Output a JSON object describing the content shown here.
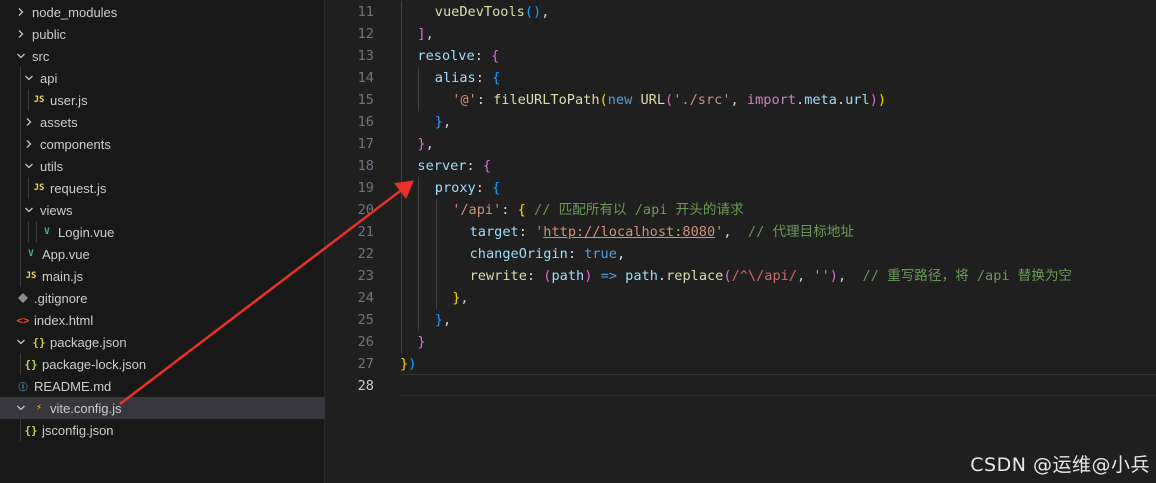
{
  "explorer": {
    "items": [
      {
        "label": "node_modules",
        "type": "folder",
        "expanded": false
      },
      {
        "label": "public",
        "type": "folder",
        "expanded": false
      },
      {
        "label": "src",
        "type": "folder",
        "expanded": true
      },
      {
        "label": "api",
        "type": "folder",
        "expanded": true
      },
      {
        "label": "user.js",
        "type": "js"
      },
      {
        "label": "assets",
        "type": "folder",
        "expanded": false
      },
      {
        "label": "components",
        "type": "folder",
        "expanded": false
      },
      {
        "label": "utils",
        "type": "folder",
        "expanded": true
      },
      {
        "label": "request.js",
        "type": "js"
      },
      {
        "label": "views",
        "type": "folder",
        "expanded": true
      },
      {
        "label": "Login.vue",
        "type": "vue"
      },
      {
        "label": "App.vue",
        "type": "vue"
      },
      {
        "label": "main.js",
        "type": "js"
      },
      {
        "label": ".gitignore",
        "type": "git"
      },
      {
        "label": "index.html",
        "type": "html"
      },
      {
        "label": "package.json",
        "type": "json",
        "expandable": true
      },
      {
        "label": "package-lock.json",
        "type": "json"
      },
      {
        "label": "README.md",
        "type": "info"
      },
      {
        "label": "vite.config.js",
        "type": "vite",
        "expandable": true,
        "selected": true
      },
      {
        "label": "jsconfig.json",
        "type": "json"
      }
    ],
    "icons": {
      "js": "JS",
      "json": "{}",
      "vue": "V",
      "html": "<>",
      "info": "ⓘ",
      "vite": "⚡"
    }
  },
  "editor": {
    "active_line": 28,
    "lines": [
      {
        "n": "11",
        "tokens": [
          [
            "t-fn",
            "vueDevTools"
          ],
          [
            "t-p3",
            "()"
          ],
          [
            "t-plain",
            ","
          ]
        ]
      },
      {
        "n": "12",
        "tokens": [
          [
            "t-p2",
            "]"
          ],
          [
            "t-plain",
            ","
          ]
        ]
      },
      {
        "n": "13",
        "tokens": [
          [
            "t-prop",
            "resolve"
          ],
          [
            "t-plain",
            ": "
          ],
          [
            "t-p2",
            "{"
          ]
        ]
      },
      {
        "n": "14",
        "tokens": [
          [
            "t-prop",
            "alias"
          ],
          [
            "t-plain",
            ": "
          ],
          [
            "t-p3",
            "{"
          ]
        ]
      },
      {
        "n": "15",
        "tokens": [
          [
            "t-str",
            "'@'"
          ],
          [
            "t-plain",
            ": "
          ],
          [
            "t-fn",
            "fileURLToPath"
          ],
          [
            "t-p1",
            "("
          ],
          [
            "t-kw",
            "new "
          ],
          [
            "t-fn",
            "URL"
          ],
          [
            "t-p2",
            "("
          ],
          [
            "t-str",
            "'./src'"
          ],
          [
            "t-plain",
            ", "
          ],
          [
            "t-ctl",
            "import"
          ],
          [
            "t-plain",
            "."
          ],
          [
            "t-prop",
            "meta"
          ],
          [
            "t-plain",
            "."
          ],
          [
            "t-prop",
            "url"
          ],
          [
            "t-p2",
            ")"
          ],
          [
            "t-p1",
            ")"
          ]
        ]
      },
      {
        "n": "16",
        "tokens": [
          [
            "t-p3",
            "}"
          ],
          [
            "t-plain",
            ","
          ]
        ]
      },
      {
        "n": "17",
        "tokens": [
          [
            "t-p2",
            "}"
          ],
          [
            "t-plain",
            ","
          ]
        ]
      },
      {
        "n": "18",
        "tokens": [
          [
            "t-prop",
            "server"
          ],
          [
            "t-plain",
            ": "
          ],
          [
            "t-p2",
            "{"
          ]
        ]
      },
      {
        "n": "19",
        "tokens": [
          [
            "t-prop",
            "proxy"
          ],
          [
            "t-plain",
            ": "
          ],
          [
            "t-p3",
            "{"
          ]
        ]
      },
      {
        "n": "20",
        "tokens": [
          [
            "t-str",
            "'/api'"
          ],
          [
            "t-plain",
            ": "
          ],
          [
            "t-p1",
            "{"
          ],
          [
            "t-plain",
            " "
          ],
          [
            "t-com",
            "// 匹配所有以 /api 开头的请求"
          ]
        ]
      },
      {
        "n": "21",
        "tokens": [
          [
            "t-prop",
            "target"
          ],
          [
            "t-plain",
            ": "
          ],
          [
            "t-str",
            "'"
          ],
          [
            "t-url",
            "http://localhost:8080"
          ],
          [
            "t-str",
            "'"
          ],
          [
            "t-plain",
            ",  "
          ],
          [
            "t-com",
            "// 代理目标地址"
          ]
        ]
      },
      {
        "n": "22",
        "tokens": [
          [
            "t-prop",
            "changeOrigin"
          ],
          [
            "t-plain",
            ": "
          ],
          [
            "t-bool",
            "true"
          ],
          [
            "t-plain",
            ","
          ]
        ]
      },
      {
        "n": "23",
        "tokens": [
          [
            "t-fn",
            "rewrite"
          ],
          [
            "t-plain",
            ": "
          ],
          [
            "t-p2",
            "("
          ],
          [
            "t-prop",
            "path"
          ],
          [
            "t-p2",
            ")"
          ],
          [
            "t-plain",
            " "
          ],
          [
            "t-kw",
            "=>"
          ],
          [
            "t-plain",
            " "
          ],
          [
            "t-prop",
            "path"
          ],
          [
            "t-plain",
            "."
          ],
          [
            "t-fn",
            "replace"
          ],
          [
            "t-p2",
            "("
          ],
          [
            "t-re",
            "/^\\/api/"
          ],
          [
            "t-plain",
            ", "
          ],
          [
            "t-str",
            "''"
          ],
          [
            "t-p2",
            ")"
          ],
          [
            "t-plain",
            ",  "
          ],
          [
            "t-com",
            "// 重写路径，将 /api 替换为空"
          ]
        ]
      },
      {
        "n": "24",
        "tokens": [
          [
            "t-p1",
            "}"
          ],
          [
            "t-plain",
            ","
          ]
        ]
      },
      {
        "n": "25",
        "tokens": [
          [
            "t-p3",
            "}"
          ],
          [
            "t-plain",
            ","
          ]
        ]
      },
      {
        "n": "26",
        "tokens": [
          [
            "t-p2",
            "}"
          ]
        ]
      },
      {
        "n": "27",
        "tokens": [
          [
            "t-p1",
            "}"
          ],
          [
            "t-p3",
            ")"
          ]
        ]
      },
      {
        "n": "28",
        "tokens": []
      }
    ]
  },
  "watermark": "CSDN @运维@小兵",
  "colors": {
    "annotation_arrow": "#e8312a",
    "selected_row": "#37373d"
  }
}
